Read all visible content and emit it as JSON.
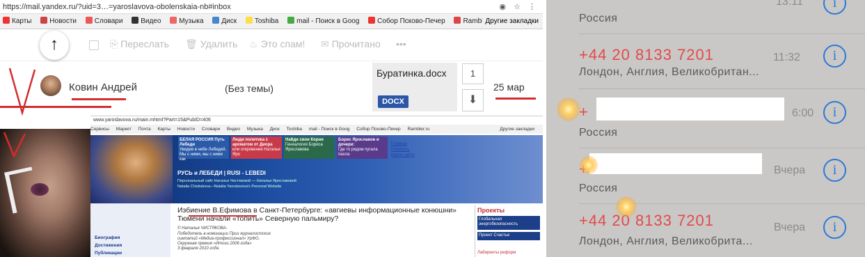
{
  "mail": {
    "url": "https://mail.yandex.ru/?uid=3…=yaroslavova-obolenskaia-nb#inbox",
    "bookmarks": [
      "Карты",
      "Новости",
      "Словари",
      "Видео",
      "Музыка",
      "Диск",
      "Toshiba",
      "mail - Поиск в Goog",
      "Собор Псково-Печер",
      "Rambler.ru"
    ],
    "bookmarks_other": "Другие закладки",
    "toolbar": {
      "forward": "Переслать",
      "delete": "Удалить",
      "spam": "Это спам!",
      "read": "Прочитано",
      "more": "•••"
    },
    "message": {
      "sender": "Ковин Андрей",
      "subject": "(Без темы)",
      "attachment_name": "Буратинка.docx",
      "attachment_type": "DOCX",
      "count": "1",
      "date": "25 мар"
    }
  },
  "site": {
    "url": "www.yaroslavova.ru/main.mhtml?Part=15&PubID=406",
    "bookmarks": [
      "Сервисы",
      "Маркет",
      "Почта",
      "Карты",
      "Новости",
      "Словари",
      "Видео",
      "Музыка",
      "Диск",
      "Toshiba",
      "mail - Поиск в Goog",
      "Собор Псково-Печер",
      "Rambler.ru"
    ],
    "bookmarks_other": "Другие закладки",
    "tiles": [
      {
        "title": "БЕЛАЯ РОССИЯ Путь Лебеди",
        "text": "Увидев в небе Лебедей, Мы с ними, мы с ними как"
      },
      {
        "title": "Люди политика с ароматом от Диора",
        "text": "или откровения Натальи Яро"
      },
      {
        "title": "Найди свои Корни",
        "text": "Генеалогия Бориса Ярославова"
      },
      {
        "title": "Борис Ярославов и дочери:",
        "text": "Где то рядом пугала пахла"
      }
    ],
    "top_links": [
      "Главная",
      "Написать",
      "Карта сайта"
    ],
    "banner_title": "РУСЬ и ЛЕБЕДИ | RUSI - LEBEDI",
    "banner_sub1": "Персональный сайт Натальи Чистяковой — Натальи Ярославовой",
    "banner_sub2": "Natalia Chistiakova—Natalia Yaroslavova's  Personal Website",
    "left_links": [
      "Биография",
      "Достижения",
      "Публикации"
    ],
    "headline": "Избиение В.Ефимова в Санкт-Петербурге: «авгиевы информационные конюшни» Тюмени начали «топить» Северную пальмиру?",
    "meta": [
      "© Наталья ЧИСТЯКОВА-",
      "Победитель в номинации Приз журналистских",
      "симпатий «Медиа-профессионал» УрФО,",
      "Окружная премия «Итоги 2006 года»",
      "3 февраля 2010 года"
    ],
    "projects_title": "Проекты",
    "projects": [
      "Глобальная энергобезопасность",
      "Проект Счастье"
    ],
    "labyrinth": "Лабиринты реформ"
  },
  "phone": {
    "rows": [
      {
        "number": "",
        "location": "Россия",
        "time": "13:11"
      },
      {
        "number": "+44 20 8133 7201",
        "location": "Лондон, Англия, Великобритан...",
        "time": "11:32"
      },
      {
        "number": "+",
        "location": "Россия",
        "time": "6:00"
      },
      {
        "number": "+",
        "location": "Россия",
        "time": "Вчера"
      },
      {
        "number": "+44 20 8133 7201",
        "location": "Лондон, Англия, Великобрита...",
        "time": "Вчера"
      }
    ],
    "info_glyph": "i"
  },
  "colors": {
    "accent_red": "#d32d2d",
    "ios_blue": "#2a78d8",
    "missed_red": "#e24a4a",
    "docx_blue": "#2b57a6"
  }
}
